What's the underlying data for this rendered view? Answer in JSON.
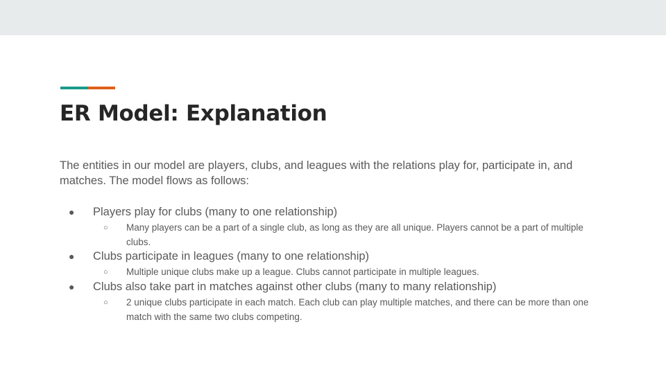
{
  "slide": {
    "title": "ER Model: Explanation",
    "intro": "The entities in our model are players, clubs, and leagues with the relations play for, participate in, and matches. The model flows as follows:",
    "accent_colors": [
      "#1a9a8a",
      "#e0601a"
    ],
    "bullet_marker": "●",
    "sub_bullet_marker": "○",
    "bullets": [
      {
        "text": "Players play for clubs (many to one relationship)",
        "sub": "Many players can be a part of a single club, as long as they are all unique. Players cannot be a part of multiple clubs."
      },
      {
        "text": "Clubs participate in leagues (many to one relationship)",
        "sub": "Multiple unique clubs make up a league. Clubs cannot participate in multiple leagues."
      },
      {
        "text": "Clubs also take part in matches against other clubs (many to many relationship)",
        "sub": "2 unique clubs participate in each match. Each club can play multiple matches, and there can be more than one match with the same two clubs competing."
      }
    ]
  }
}
